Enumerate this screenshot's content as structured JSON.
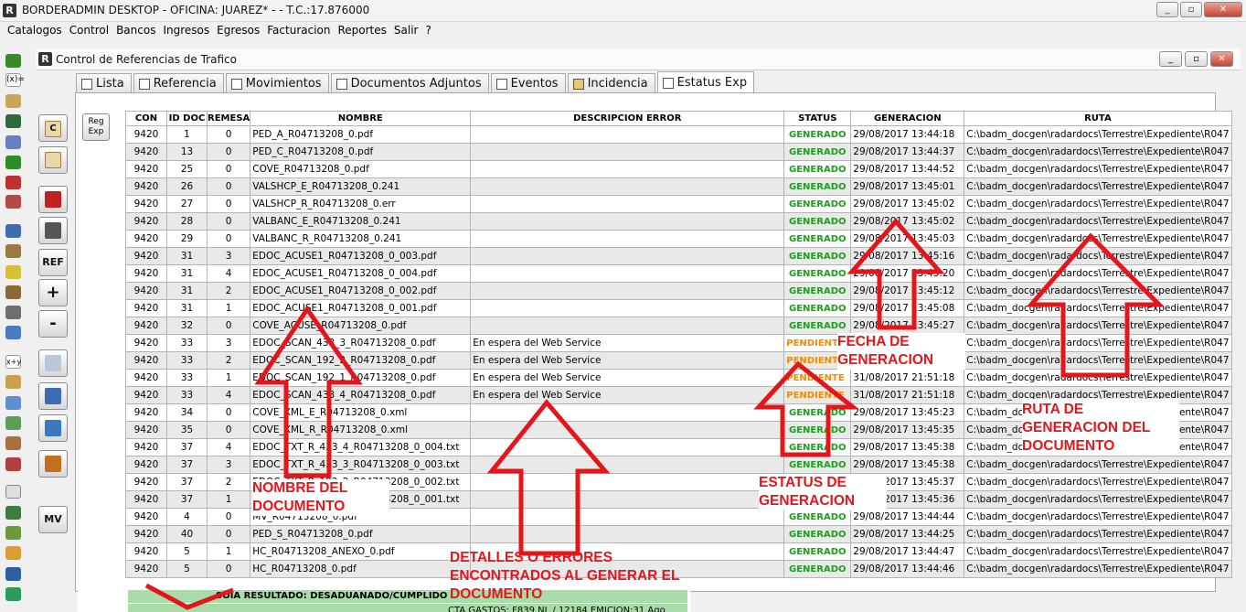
{
  "window": {
    "title": "BORDERADMIN DESKTOP - OFICINA: JUAREZ* -   - T.C.:17.876000",
    "app_icon": "R"
  },
  "menu": [
    "Catalogos",
    "Control",
    "Bancos",
    "Ingresos",
    "Egresos",
    "Facturacion",
    "Reportes",
    "Salir",
    "?"
  ],
  "toolbar": {
    "c": "C",
    "ref": "REF",
    "plus": "+",
    "minus": "-",
    "mv": "MV"
  },
  "inner": {
    "title": "Control de Referencias de Trafico",
    "icon": "R"
  },
  "tabs": [
    "Lista",
    "Referencia",
    "Movimientos",
    "Documentos Adjuntos",
    "Eventos",
    "Incidencia",
    "Estatus Exp"
  ],
  "reg_exp": "Reg Exp",
  "grid": {
    "headers": [
      "CON",
      "ID DOC",
      "REMESA",
      "NOMBRE",
      "DESCRIPCION ERROR",
      "STATUS",
      "GENERACION",
      "RUTA"
    ],
    "rows": [
      [
        "9420",
        "1",
        "0",
        "PED_A_R04713208_0.pdf",
        "",
        "GENERADO",
        "29/08/2017 13:44:18",
        "C:\\badm_docgen\\radardocs\\Terrestre\\Expediente\\R047"
      ],
      [
        "9420",
        "13",
        "0",
        "PED_C_R04713208_0.pdf",
        "",
        "GENERADO",
        "29/08/2017 13:44:37",
        "C:\\badm_docgen\\radardocs\\Terrestre\\Expediente\\R047"
      ],
      [
        "9420",
        "25",
        "0",
        "COVE_R04713208_0.pdf",
        "",
        "GENERADO",
        "29/08/2017 13:44:52",
        "C:\\badm_docgen\\radardocs\\Terrestre\\Expediente\\R047"
      ],
      [
        "9420",
        "26",
        "0",
        "VALSHCP_E_R04713208_0.241",
        "",
        "GENERADO",
        "29/08/2017 13:45:01",
        "C:\\badm_docgen\\radardocs\\Terrestre\\Expediente\\R047"
      ],
      [
        "9420",
        "27",
        "0",
        "VALSHCP_R_R04713208_0.err",
        "",
        "GENERADO",
        "29/08/2017 13:45:02",
        "C:\\badm_docgen\\radardocs\\Terrestre\\Expediente\\R047"
      ],
      [
        "9420",
        "28",
        "0",
        "VALBANC_E_R04713208_0.241",
        "",
        "GENERADO",
        "29/08/2017 13:45:02",
        "C:\\badm_docgen\\radardocs\\Terrestre\\Expediente\\R047"
      ],
      [
        "9420",
        "29",
        "0",
        "VALBANC_R_R04713208_0.241",
        "",
        "GENERADO",
        "29/08/2017 13:45:03",
        "C:\\badm_docgen\\radardocs\\Terrestre\\Expediente\\R047"
      ],
      [
        "9420",
        "31",
        "3",
        "EDOC_ACUSE1_R04713208_0_003.pdf",
        "",
        "GENERADO",
        "29/08/2017 13:45:16",
        "C:\\badm_docgen\\radardocs\\Terrestre\\Expediente\\R047"
      ],
      [
        "9420",
        "31",
        "4",
        "EDOC_ACUSE1_R04713208_0_004.pdf",
        "",
        "GENERADO",
        "29/08/2017 13:45:20",
        "C:\\badm_docgen\\radardocs\\Terrestre\\Expediente\\R047"
      ],
      [
        "9420",
        "31",
        "2",
        "EDOC_ACUSE1_R04713208_0_002.pdf",
        "",
        "GENERADO",
        "29/08/2017 13:45:12",
        "C:\\badm_docgen\\radardocs\\Terrestre\\Expediente\\R047"
      ],
      [
        "9420",
        "31",
        "1",
        "EDOC_ACUSE1_R04713208_0_001.pdf",
        "",
        "GENERADO",
        "29/08/2017 13:45:08",
        "C:\\badm_docgen\\radardocs\\Terrestre\\Expediente\\R047"
      ],
      [
        "9420",
        "32",
        "0",
        "COVE_ACUSE_R04713208_0.pdf",
        "",
        "GENERADO",
        "29/08/2017 13:45:27",
        "C:\\badm_docgen\\radardocs\\Terrestre\\Expediente\\R047"
      ],
      [
        "9420",
        "33",
        "3",
        "EDOC_SCAN_433_3_R04713208_0.pdf",
        "En espera del Web Service",
        "PENDIENTE",
        "31/08/2017 21:51:18",
        "C:\\badm_docgen\\radardocs\\Terrestre\\Expediente\\R047"
      ],
      [
        "9420",
        "33",
        "2",
        "EDOC_SCAN_192_2_R04713208_0.pdf",
        "En espera del Web Service",
        "PENDIENTE",
        "31/08/2017 21:51:18",
        "C:\\badm_docgen\\radardocs\\Terrestre\\Expediente\\R047"
      ],
      [
        "9420",
        "33",
        "1",
        "EDOC_SCAN_192_1_R04713208_0.pdf",
        "En espera del Web Service",
        "PENDIENTE",
        "31/08/2017 21:51:18",
        "C:\\badm_docgen\\radardocs\\Terrestre\\Expediente\\R047"
      ],
      [
        "9420",
        "33",
        "4",
        "EDOC_SCAN_433_4_R04713208_0.pdf",
        "En espera del Web Service",
        "PENDIENTE",
        "31/08/2017 21:51:18",
        "C:\\badm_docgen\\radardocs\\Terrestre\\Expediente\\R047"
      ],
      [
        "9420",
        "34",
        "0",
        "COVE_XML_E_R04713208_0.xml",
        "",
        "GENERADO",
        "29/08/2017 13:45:23",
        "C:\\badm_docgen\\radardocs\\Terrestre\\Expediente\\R047"
      ],
      [
        "9420",
        "35",
        "0",
        "COVE_XML_R_R04713208_0.xml",
        "",
        "GENERADO",
        "29/08/2017 13:45:35",
        "C:\\badm_docgen\\radardocs\\Terrestre\\Expediente\\R047"
      ],
      [
        "9420",
        "37",
        "4",
        "EDOC_TXT_R_433_4_R04713208_0_004.txt",
        "",
        "GENERADO",
        "29/08/2017 13:45:38",
        "C:\\badm_docgen\\radardocs\\Terrestre\\Expediente\\R047"
      ],
      [
        "9420",
        "37",
        "3",
        "EDOC_TXT_R_433_3_R04713208_0_003.txt",
        "",
        "GENERADO",
        "29/08/2017 13:45:38",
        "C:\\badm_docgen\\radardocs\\Terrestre\\Expediente\\R047"
      ],
      [
        "9420",
        "37",
        "2",
        "EDOC_TXT_R_192_2_R04713208_0_002.txt",
        "",
        "GENERADO",
        "29/08/2017 13:45:37",
        "C:\\badm_docgen\\radardocs\\Terrestre\\Expediente\\R047"
      ],
      [
        "9420",
        "37",
        "1",
        "EDOC_TXT_R_192_1_R04713208_0_001.txt",
        "",
        "GENERADO",
        "29/08/2017 13:45:36",
        "C:\\badm_docgen\\radardocs\\Terrestre\\Expediente\\R047"
      ],
      [
        "9420",
        "4",
        "0",
        "MV_R04713208_0.pdf",
        "",
        "GENERADO",
        "29/08/2017 13:44:44",
        "C:\\badm_docgen\\radardocs\\Terrestre\\Expediente\\R047"
      ],
      [
        "9420",
        "40",
        "0",
        "PED_S_R04713208_0.pdf",
        "",
        "GENERADO",
        "29/08/2017 13:44:25",
        "C:\\badm_docgen\\radardocs\\Terrestre\\Expediente\\R047"
      ],
      [
        "9420",
        "5",
        "1",
        "HC_R04713208_ANEXO_0.pdf",
        "",
        "GENERADO",
        "29/08/2017 13:44:47",
        "C:\\badm_docgen\\radardocs\\Terrestre\\Expediente\\R047"
      ],
      [
        "9420",
        "5",
        "0",
        "HC_R04713208_0.pdf",
        "",
        "GENERADO",
        "29/08/2017 13:44:46",
        "C:\\badm_docgen\\radardocs\\Terrestre\\Expediente\\R047"
      ]
    ]
  },
  "bottom": {
    "line1": "SOIA RESULTADO: DESADUANADO/CUMPLIDO",
    "line2": "CTA GASTOS: F839 NL / 12184 EMICION:31 Ago"
  },
  "annotations": {
    "fecha": "FECHA DE GENERACION",
    "ruta": "RUTA DE GENERACION DEL DOCUMENTO",
    "nombre": "NOMBRE DEL DOCUMENTO",
    "estatus": "ESTATUS DE GENERACION",
    "detalles": "DETALLES O ERRORES ENCONTRADOS AL GENERAR EL DOCUMENTO"
  },
  "colors": {
    "generado": "#1aa01a",
    "pendiente": "#f08c00",
    "annotation": "#e4161b",
    "row_alt": "#e9e9e9"
  }
}
